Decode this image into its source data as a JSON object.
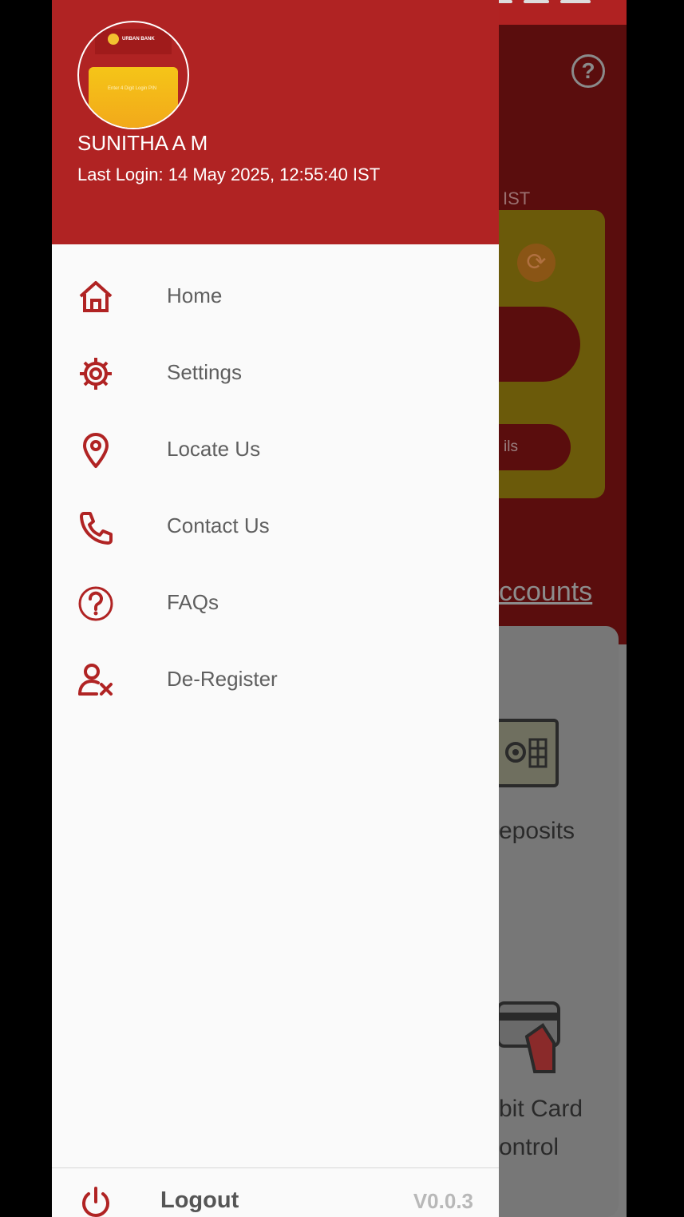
{
  "drawer": {
    "user_name": "SUNITHA A M",
    "last_login": "Last Login: 14 May 2025, 12:55:40 IST",
    "avatar": {
      "bank_name": "URBAN BANK",
      "pin_hint": "Enter 4 Digit Login PIN"
    },
    "menu": [
      {
        "label": "Home",
        "icon": "home-icon"
      },
      {
        "label": "Settings",
        "icon": "gear-icon"
      },
      {
        "label": "Locate Us",
        "icon": "location-pin-icon"
      },
      {
        "label": "Contact Us",
        "icon": "phone-icon"
      },
      {
        "label": "FAQs",
        "icon": "question-icon"
      },
      {
        "label": "De-Register",
        "icon": "user-remove-icon"
      }
    ],
    "footer": {
      "logout_label": "Logout",
      "version": "V0.0.3"
    }
  },
  "background": {
    "ist": "IST",
    "details_fragment": "ils",
    "accounts_fragment": "ccounts",
    "deposits_fragment": "eposits",
    "debit_line1": "bit Card",
    "debit_line2": "ontrol"
  },
  "colors": {
    "brand_red": "#b02323",
    "accent_yellow": "#f5c518",
    "icon_red": "#b02323"
  }
}
